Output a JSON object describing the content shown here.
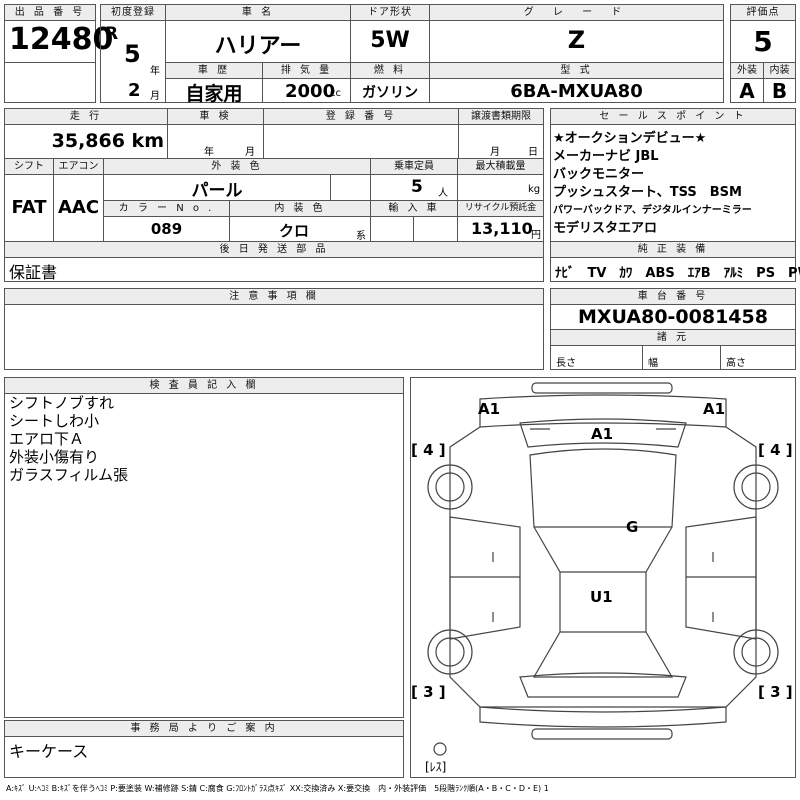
{
  "headers": {
    "lot": "出 品 番 号",
    "first_reg": "初度登録",
    "model": "車 名",
    "door": "ドア形状",
    "grade": "グ レ ー ド",
    "score": "評価点",
    "history": "車 歴",
    "displacement": "排 気 量",
    "fuel": "燃 料",
    "type": "型 式",
    "exterior": "外装",
    "interior": "内装",
    "mileage": "走 行",
    "inspection": "車 検",
    "reg_no": "登 録 番 号",
    "transfer": "譲渡書類期限",
    "sales_points": "セ ー ル ス ポ イ ン ト",
    "shift": "シフト",
    "aircon": "エアコン",
    "ext_color": "外 装 色",
    "capacity": "乗車定員",
    "max_load": "最大積載量",
    "color_no": "カ ラ ー N o .",
    "int_color": "内 装 色",
    "import": "輸 入 車",
    "recycle": "リサイクル預託金",
    "later_parts": "後 日 発 送 部 品",
    "genuine": "純 正 装 備",
    "notes": "注 意 事 項 欄",
    "chassis": "車 台 番 号",
    "specs": "諸 元",
    "inspector": "検 査 員 記 入 欄",
    "office": "事 務 局 よ り ご 案 内"
  },
  "lot_number": "12480",
  "first_reg": {
    "era": "R",
    "year": "5",
    "year_unit": "年",
    "month": "2",
    "month_unit": "月"
  },
  "model_name": "ハリアー",
  "door_type": "5W",
  "grade": "Z",
  "score": "5",
  "history": "自家用",
  "displacement": {
    "value": "2000",
    "unit": "cc"
  },
  "fuel": "ガソリン",
  "model_code": "6BA-MXUA80",
  "exterior_grade": "A",
  "interior_grade": "B",
  "mileage": "35,866 km",
  "inspection": {
    "year_unit": "年",
    "month_unit": "月"
  },
  "transfer": {
    "month_unit": "月",
    "day_unit": "日"
  },
  "sales_points": [
    "★オークションデビュー★",
    "メーカーナビ JBL",
    "バックモニター",
    "プッシュスタート、TSS　BSM",
    "パワーバックドア、デジタルインナーミラー",
    "モデリスタエアロ"
  ],
  "shift": "FAT",
  "aircon": "AAC",
  "ext_color": "パール",
  "capacity": {
    "value": "5",
    "unit": "人"
  },
  "max_load": {
    "unit": "kg"
  },
  "color_no": "089",
  "int_color": {
    "value": "クロ",
    "unit": "系"
  },
  "recycle": {
    "value": "13,110",
    "unit": "円"
  },
  "later_parts": "保証書",
  "genuine_equipment": "ﾅﾋﾞ　TV　ｶﾜ　ABS　ｴｱB　ｱﾙﾐ　PS　PW",
  "chassis_number": "MXUA80-0081458",
  "specs": {
    "length": "長さ",
    "width": "幅",
    "height": "高さ"
  },
  "inspector_notes": [
    "シフトノブすれ",
    "シートしわ小",
    "エアロ下Ａ",
    "外装小傷有り",
    "ガラスフィルム張"
  ],
  "office_notes": "キーケース",
  "diagram": {
    "a1_left": "A1",
    "a1_right": "A1",
    "a1_center": "A1",
    "g": "G",
    "u1": "U1",
    "tag_4_left": "[ 4 ]",
    "tag_4_right": "[ 4 ]",
    "tag_3_left": "[ 3 ]",
    "tag_3_right": "[ 3 ]",
    "spare": "[ﾚｽ]"
  },
  "legend": "A:ｷｽﾞ U:ﾍｺﾐ B:ｷｽﾞを伴うﾍｺﾐ P:要塗装 W:補修跡 S:錆 C:腐食 G:ﾌﾛﾝﾄｶﾞﾗｽ点ｷｽﾞ XX:交換済み X:要交換　内・外装評価　5段階ﾗﾝｸ順(A・B・C・D・E) 1"
}
